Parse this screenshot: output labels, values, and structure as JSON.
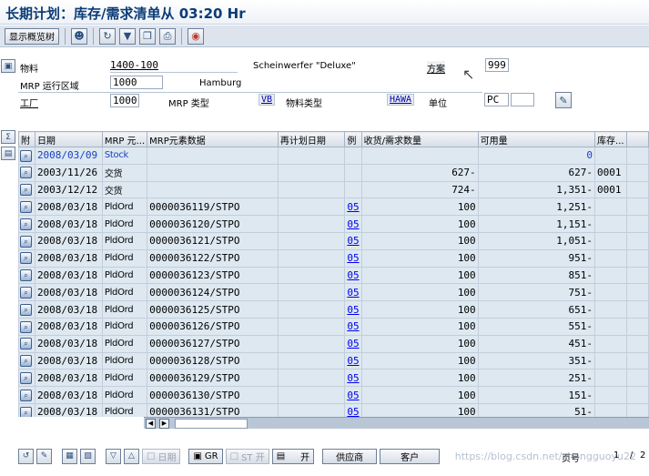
{
  "window": {
    "title": "长期计划：库存/需求清单从 03:20 Hr"
  },
  "app_toolbar": {
    "display_overview_label": "显示概览树",
    "icons": [
      "person-icon",
      "refresh-icon",
      "filter-icon",
      "copy-icon",
      "print-icon",
      "color-icon"
    ]
  },
  "header": {
    "material_label": "物料",
    "material_value": "1400-100",
    "material_desc": "Scheinwerfer \"Deluxe\"",
    "scenario_label": "方案",
    "scenario_value": "999",
    "mrp_area_label": "MRP 运行区域",
    "mrp_area_value": "1000",
    "mrp_area_name": "Hamburg",
    "plant_label": "工厂",
    "plant_value": "1000",
    "mrp_type_label": "MRP 类型",
    "mrp_type_value": "VB",
    "material_type_label": "物料类型",
    "material_type_value": "HAWA",
    "unit_label": "单位",
    "unit_value": "PC"
  },
  "table": {
    "columns": [
      "附",
      "日期",
      "MRP 元...",
      "MRP元素数据",
      "再计划日期",
      "例",
      "收货/需求数量",
      "可用量",
      "库存..."
    ],
    "rows": [
      {
        "date": "2008/03/09",
        "element": "Stock",
        "data": "",
        "resched": "",
        "exc": "",
        "qty": "",
        "avail": "0",
        "stor": ""
      },
      {
        "date": "2003/11/26",
        "element": "交货",
        "data": "",
        "resched": "",
        "exc": "",
        "qty": "627-",
        "avail": "627-",
        "stor": "0001"
      },
      {
        "date": "2003/12/12",
        "element": "交货",
        "data": "",
        "resched": "",
        "exc": "",
        "qty": "724-",
        "avail": "1,351-",
        "stor": "0001"
      },
      {
        "date": "2008/03/18",
        "element": "PldOrd",
        "data": "0000036119/STPO",
        "resched": "",
        "exc": "05",
        "qty": "100",
        "avail": "1,251-",
        "stor": ""
      },
      {
        "date": "2008/03/18",
        "element": "PldOrd",
        "data": "0000036120/STPO",
        "resched": "",
        "exc": "05",
        "qty": "100",
        "avail": "1,151-",
        "stor": ""
      },
      {
        "date": "2008/03/18",
        "element": "PldOrd",
        "data": "0000036121/STPO",
        "resched": "",
        "exc": "05",
        "qty": "100",
        "avail": "1,051-",
        "stor": ""
      },
      {
        "date": "2008/03/18",
        "element": "PldOrd",
        "data": "0000036122/STPO",
        "resched": "",
        "exc": "05",
        "qty": "100",
        "avail": "951-",
        "stor": ""
      },
      {
        "date": "2008/03/18",
        "element": "PldOrd",
        "data": "0000036123/STPO",
        "resched": "",
        "exc": "05",
        "qty": "100",
        "avail": "851-",
        "stor": ""
      },
      {
        "date": "2008/03/18",
        "element": "PldOrd",
        "data": "0000036124/STPO",
        "resched": "",
        "exc": "05",
        "qty": "100",
        "avail": "751-",
        "stor": ""
      },
      {
        "date": "2008/03/18",
        "element": "PldOrd",
        "data": "0000036125/STPO",
        "resched": "",
        "exc": "05",
        "qty": "100",
        "avail": "651-",
        "stor": ""
      },
      {
        "date": "2008/03/18",
        "element": "PldOrd",
        "data": "0000036126/STPO",
        "resched": "",
        "exc": "05",
        "qty": "100",
        "avail": "551-",
        "stor": ""
      },
      {
        "date": "2008/03/18",
        "element": "PldOrd",
        "data": "0000036127/STPO",
        "resched": "",
        "exc": "05",
        "qty": "100",
        "avail": "451-",
        "stor": ""
      },
      {
        "date": "2008/03/18",
        "element": "PldOrd",
        "data": "0000036128/STPO",
        "resched": "",
        "exc": "05",
        "qty": "100",
        "avail": "351-",
        "stor": ""
      },
      {
        "date": "2008/03/18",
        "element": "PldOrd",
        "data": "0000036129/STPO",
        "resched": "",
        "exc": "05",
        "qty": "100",
        "avail": "251-",
        "stor": ""
      },
      {
        "date": "2008/03/18",
        "element": "PldOrd",
        "data": "0000036130/STPO",
        "resched": "",
        "exc": "05",
        "qty": "100",
        "avail": "151-",
        "stor": ""
      },
      {
        "date": "2008/03/18",
        "element": "PldOrd",
        "data": "0000036131/STPO",
        "resched": "",
        "exc": "05",
        "qty": "100",
        "avail": "51-",
        "stor": ""
      }
    ]
  },
  "bottom_toolbar": {
    "date_label": "日期",
    "gr_label": "GR",
    "st_open_label": "ST 开",
    "open_label": "开",
    "vendor_label": "供应商",
    "customer_label": "客户",
    "page_label": "页号",
    "page_current": "1",
    "page_sep": "/",
    "page_total": "2"
  },
  "watermark": "https://blog.csdn.net/zhangguoyu22"
}
